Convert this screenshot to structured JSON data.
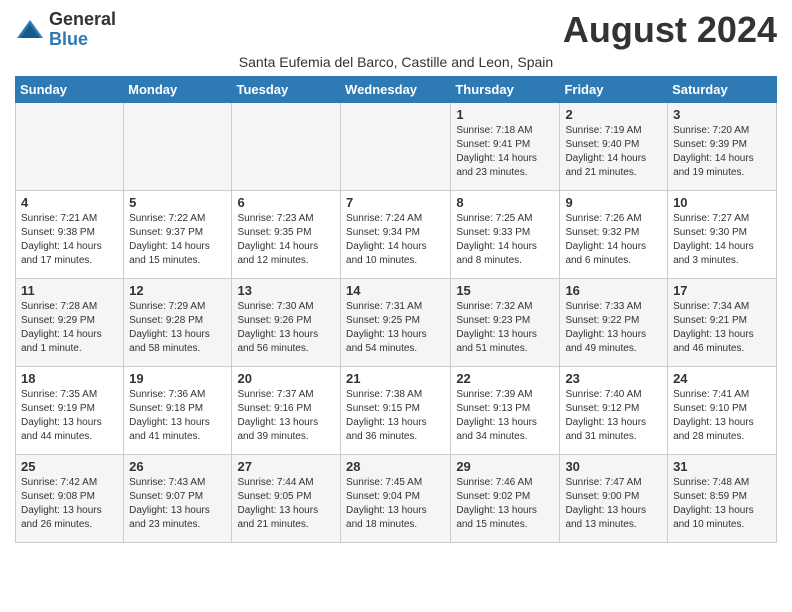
{
  "header": {
    "logo_general": "General",
    "logo_blue": "Blue",
    "month_title": "August 2024",
    "subtitle": "Santa Eufemia del Barco, Castille and Leon, Spain"
  },
  "days_of_week": [
    "Sunday",
    "Monday",
    "Tuesday",
    "Wednesday",
    "Thursday",
    "Friday",
    "Saturday"
  ],
  "weeks": [
    [
      {
        "day": "",
        "sunrise": "",
        "sunset": "",
        "daylight": ""
      },
      {
        "day": "",
        "sunrise": "",
        "sunset": "",
        "daylight": ""
      },
      {
        "day": "",
        "sunrise": "",
        "sunset": "",
        "daylight": ""
      },
      {
        "day": "",
        "sunrise": "",
        "sunset": "",
        "daylight": ""
      },
      {
        "day": "1",
        "sunrise": "Sunrise: 7:18 AM",
        "sunset": "Sunset: 9:41 PM",
        "daylight": "Daylight: 14 hours and 23 minutes."
      },
      {
        "day": "2",
        "sunrise": "Sunrise: 7:19 AM",
        "sunset": "Sunset: 9:40 PM",
        "daylight": "Daylight: 14 hours and 21 minutes."
      },
      {
        "day": "3",
        "sunrise": "Sunrise: 7:20 AM",
        "sunset": "Sunset: 9:39 PM",
        "daylight": "Daylight: 14 hours and 19 minutes."
      }
    ],
    [
      {
        "day": "4",
        "sunrise": "Sunrise: 7:21 AM",
        "sunset": "Sunset: 9:38 PM",
        "daylight": "Daylight: 14 hours and 17 minutes."
      },
      {
        "day": "5",
        "sunrise": "Sunrise: 7:22 AM",
        "sunset": "Sunset: 9:37 PM",
        "daylight": "Daylight: 14 hours and 15 minutes."
      },
      {
        "day": "6",
        "sunrise": "Sunrise: 7:23 AM",
        "sunset": "Sunset: 9:35 PM",
        "daylight": "Daylight: 14 hours and 12 minutes."
      },
      {
        "day": "7",
        "sunrise": "Sunrise: 7:24 AM",
        "sunset": "Sunset: 9:34 PM",
        "daylight": "Daylight: 14 hours and 10 minutes."
      },
      {
        "day": "8",
        "sunrise": "Sunrise: 7:25 AM",
        "sunset": "Sunset: 9:33 PM",
        "daylight": "Daylight: 14 hours and 8 minutes."
      },
      {
        "day": "9",
        "sunrise": "Sunrise: 7:26 AM",
        "sunset": "Sunset: 9:32 PM",
        "daylight": "Daylight: 14 hours and 6 minutes."
      },
      {
        "day": "10",
        "sunrise": "Sunrise: 7:27 AM",
        "sunset": "Sunset: 9:30 PM",
        "daylight": "Daylight: 14 hours and 3 minutes."
      }
    ],
    [
      {
        "day": "11",
        "sunrise": "Sunrise: 7:28 AM",
        "sunset": "Sunset: 9:29 PM",
        "daylight": "Daylight: 14 hours and 1 minute."
      },
      {
        "day": "12",
        "sunrise": "Sunrise: 7:29 AM",
        "sunset": "Sunset: 9:28 PM",
        "daylight": "Daylight: 13 hours and 58 minutes."
      },
      {
        "day": "13",
        "sunrise": "Sunrise: 7:30 AM",
        "sunset": "Sunset: 9:26 PM",
        "daylight": "Daylight: 13 hours and 56 minutes."
      },
      {
        "day": "14",
        "sunrise": "Sunrise: 7:31 AM",
        "sunset": "Sunset: 9:25 PM",
        "daylight": "Daylight: 13 hours and 54 minutes."
      },
      {
        "day": "15",
        "sunrise": "Sunrise: 7:32 AM",
        "sunset": "Sunset: 9:23 PM",
        "daylight": "Daylight: 13 hours and 51 minutes."
      },
      {
        "day": "16",
        "sunrise": "Sunrise: 7:33 AM",
        "sunset": "Sunset: 9:22 PM",
        "daylight": "Daylight: 13 hours and 49 minutes."
      },
      {
        "day": "17",
        "sunrise": "Sunrise: 7:34 AM",
        "sunset": "Sunset: 9:21 PM",
        "daylight": "Daylight: 13 hours and 46 minutes."
      }
    ],
    [
      {
        "day": "18",
        "sunrise": "Sunrise: 7:35 AM",
        "sunset": "Sunset: 9:19 PM",
        "daylight": "Daylight: 13 hours and 44 minutes."
      },
      {
        "day": "19",
        "sunrise": "Sunrise: 7:36 AM",
        "sunset": "Sunset: 9:18 PM",
        "daylight": "Daylight: 13 hours and 41 minutes."
      },
      {
        "day": "20",
        "sunrise": "Sunrise: 7:37 AM",
        "sunset": "Sunset: 9:16 PM",
        "daylight": "Daylight: 13 hours and 39 minutes."
      },
      {
        "day": "21",
        "sunrise": "Sunrise: 7:38 AM",
        "sunset": "Sunset: 9:15 PM",
        "daylight": "Daylight: 13 hours and 36 minutes."
      },
      {
        "day": "22",
        "sunrise": "Sunrise: 7:39 AM",
        "sunset": "Sunset: 9:13 PM",
        "daylight": "Daylight: 13 hours and 34 minutes."
      },
      {
        "day": "23",
        "sunrise": "Sunrise: 7:40 AM",
        "sunset": "Sunset: 9:12 PM",
        "daylight": "Daylight: 13 hours and 31 minutes."
      },
      {
        "day": "24",
        "sunrise": "Sunrise: 7:41 AM",
        "sunset": "Sunset: 9:10 PM",
        "daylight": "Daylight: 13 hours and 28 minutes."
      }
    ],
    [
      {
        "day": "25",
        "sunrise": "Sunrise: 7:42 AM",
        "sunset": "Sunset: 9:08 PM",
        "daylight": "Daylight: 13 hours and 26 minutes."
      },
      {
        "day": "26",
        "sunrise": "Sunrise: 7:43 AM",
        "sunset": "Sunset: 9:07 PM",
        "daylight": "Daylight: 13 hours and 23 minutes."
      },
      {
        "day": "27",
        "sunrise": "Sunrise: 7:44 AM",
        "sunset": "Sunset: 9:05 PM",
        "daylight": "Daylight: 13 hours and 21 minutes."
      },
      {
        "day": "28",
        "sunrise": "Sunrise: 7:45 AM",
        "sunset": "Sunset: 9:04 PM",
        "daylight": "Daylight: 13 hours and 18 minutes."
      },
      {
        "day": "29",
        "sunrise": "Sunrise: 7:46 AM",
        "sunset": "Sunset: 9:02 PM",
        "daylight": "Daylight: 13 hours and 15 minutes."
      },
      {
        "day": "30",
        "sunrise": "Sunrise: 7:47 AM",
        "sunset": "Sunset: 9:00 PM",
        "daylight": "Daylight: 13 hours and 13 minutes."
      },
      {
        "day": "31",
        "sunrise": "Sunrise: 7:48 AM",
        "sunset": "Sunset: 8:59 PM",
        "daylight": "Daylight: 13 hours and 10 minutes."
      }
    ]
  ]
}
